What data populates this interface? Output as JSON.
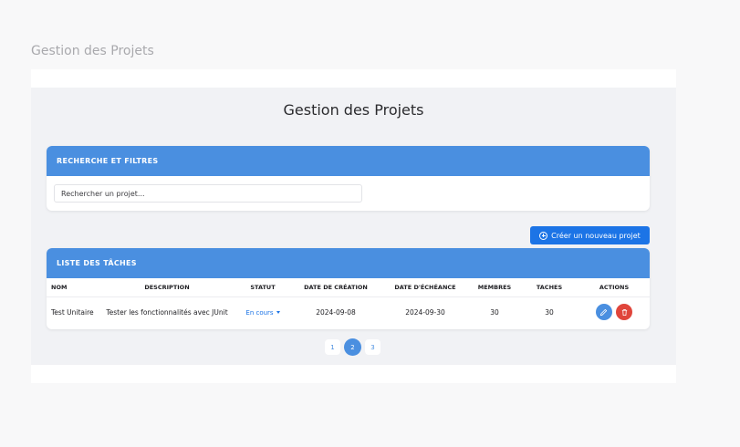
{
  "page": {
    "heading": "Gestion des Projets",
    "title": "Gestion des Projets"
  },
  "search": {
    "header": "RECHERCHE ET FILTRES",
    "placeholder": "Rechercher un projet..."
  },
  "create_button": {
    "label": "Créer un nouveau projet",
    "icon": "plus-circle-icon"
  },
  "table": {
    "header": "LISTE DES TÂCHES",
    "columns": [
      "NOM",
      "DESCRIPTION",
      "STATUT",
      "DATE DE CRÉATION",
      "DATE D'ÉCHÉANCE",
      "MEMBRES",
      "TACHES",
      "ACTIONS"
    ],
    "rows": [
      {
        "nom": "Test Unitaire",
        "description": "Tester les fonctionnalités avec JUnit",
        "statut": "En cours",
        "date_creation": "2024-09-08",
        "date_echeance": "2024-09-30",
        "membres": "30",
        "taches": "30"
      }
    ]
  },
  "pagination": {
    "pages": [
      "1",
      "2",
      "3"
    ],
    "current": "2"
  },
  "colors": {
    "accent": "#4a8fe0",
    "primary_button": "#1c74e6",
    "danger": "#e0453b"
  }
}
